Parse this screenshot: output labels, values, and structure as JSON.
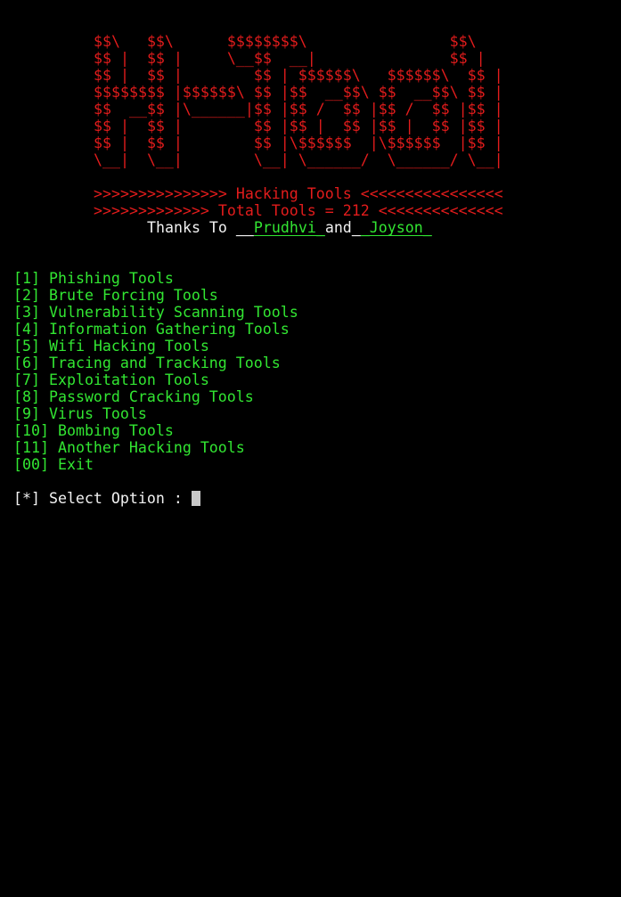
{
  "banner_lines": [
    "$$\\   $$\\      $$$$$$$$\\                $$\\",
    "$$ |  $$ |     \\__$$  __|               $$ |",
    "$$ |  $$ |        $$ | $$$$$$\\   $$$$$$\\  $$ |",
    "$$$$$$$$ |$$$$$$\\ $$ |$$  __$$\\ $$  __$$\\ $$ |",
    "$$  __$$ |\\______|$$ |$$ /  $$ |$$ /  $$ |$$ |",
    "$$ |  $$ |        $$ |$$ |  $$ |$$ |  $$ |$$ |",
    "$$ |  $$ |        $$ |\\$$$$$$  |\\$$$$$$  |$$ |",
    "\\__|  \\__|        \\__| \\______/  \\______/ \\__|"
  ],
  "header": {
    "title_line": ">>>>>>>>>>>>>>> Hacking Tools <<<<<<<<<<<<<<<<",
    "total_line": ">>>>>>>>>>>>> Total Tools = 212 <<<<<<<<<<<<<<",
    "thanks_prefix": "Thanks To ",
    "underscore_1": "__",
    "name_1": "Prudhvi_",
    "joiner": "and",
    "underscore_2": "_",
    "name_2": "_Joyson_"
  },
  "menu": [
    {
      "key": "[1]",
      "label": "Phishing Tools"
    },
    {
      "key": "[2]",
      "label": "Brute Forcing Tools"
    },
    {
      "key": "[3]",
      "label": "Vulnerability Scanning Tools"
    },
    {
      "key": "[4]",
      "label": "Information Gathering Tools"
    },
    {
      "key": "[5]",
      "label": "Wifi Hacking Tools"
    },
    {
      "key": "[6]",
      "label": "Tracing and Tracking Tools"
    },
    {
      "key": "[7]",
      "label": "Exploitation Tools"
    },
    {
      "key": "[8]",
      "label": "Password Cracking Tools"
    },
    {
      "key": "[9]",
      "label": "Virus Tools"
    },
    {
      "key": "[10]",
      "label": "Bombing Tools"
    },
    {
      "key": "[11]",
      "label": "Another Hacking Tools"
    },
    {
      "key": "[00]",
      "label": "Exit"
    }
  ],
  "prompt": {
    "text": "[*] Select Option : "
  },
  "colors": {
    "background": "#000000",
    "banner": "#e31c1c",
    "menu": "#32e632",
    "prompt": "#f2f2f2"
  }
}
